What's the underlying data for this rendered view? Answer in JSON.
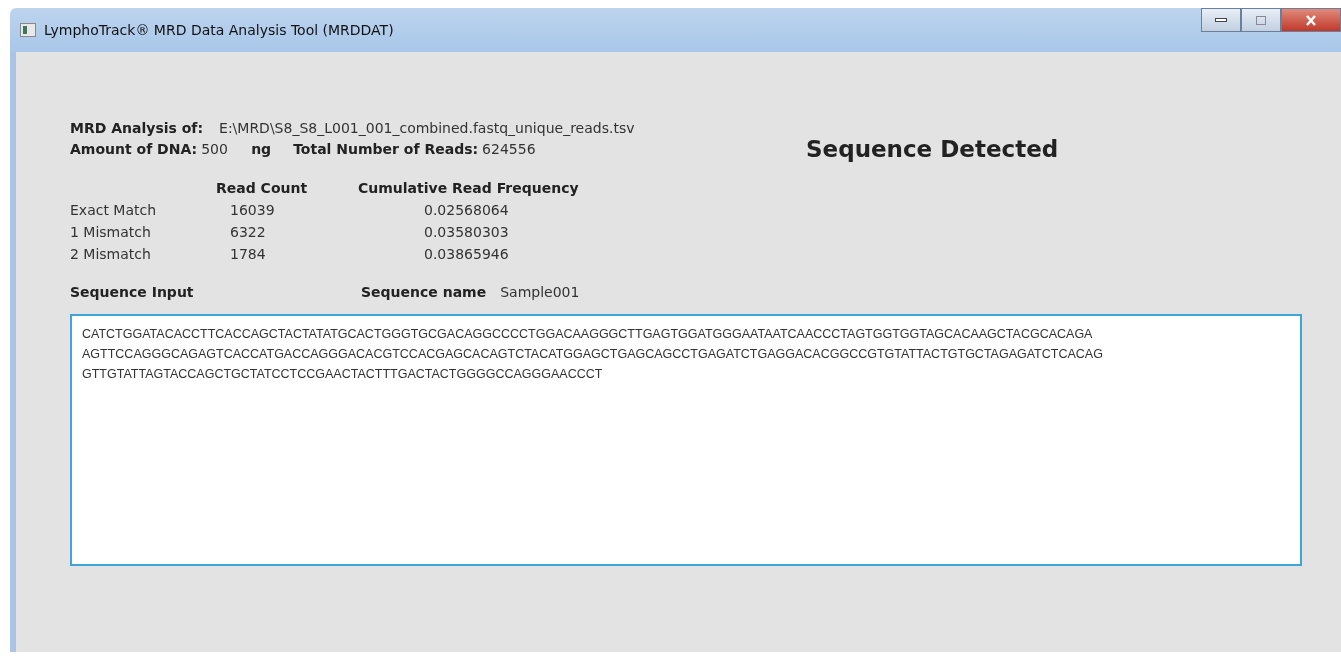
{
  "window": {
    "title": "LymphoTrack® MRD Data Analysis Tool (MRDDAT)"
  },
  "analysis": {
    "label": "MRD Analysis of:",
    "file": "E:\\MRD\\S8_S8_L001_001_combined.fastq_unique_reads.tsv"
  },
  "dna": {
    "label": "Amount of DNA:",
    "value": "500",
    "unit": "ng"
  },
  "reads": {
    "label": "Total Number of Reads:",
    "value": "624556"
  },
  "status": "Sequence Detected",
  "table": {
    "columns": [
      "Read Count",
      "Cumulative Read Frequency"
    ],
    "rows": [
      {
        "label": "Exact Match",
        "count": "16039",
        "frequency": "0.02568064"
      },
      {
        "label": "1 Mismatch",
        "count": "6322",
        "frequency": "0.03580303"
      },
      {
        "label": "2 Mismatch",
        "count": "1784",
        "frequency": "0.03865946"
      }
    ]
  },
  "sequence_input": {
    "label": "Sequence Input",
    "name_label": "Sequence name",
    "name": "Sample001",
    "lines": [
      "CATCTGGATACACCTTCACCAGCTACTATATGCACTGGGTGCGACAGGCCCCTGGACAAGGGCTTGAGTGGATGGGAATAATCAACCCTAGTGGTGGTAGCACAAGCTACGCACAGA",
      "AGTTCCAGGGCAGAGTCACCATGACCAGGGACACGTCCACGAGCACAGTCTACATGGAGCTGAGCAGCCTGAGATCTGAGGACACGGCCGTGTATTACTGTGCTAGAGATCTCACAG",
      "GTTGTATTAGTACCAGCTGCTATCCTCCGAACTACTTTGACTACTGGGGCCAGGGAACCCT"
    ]
  }
}
